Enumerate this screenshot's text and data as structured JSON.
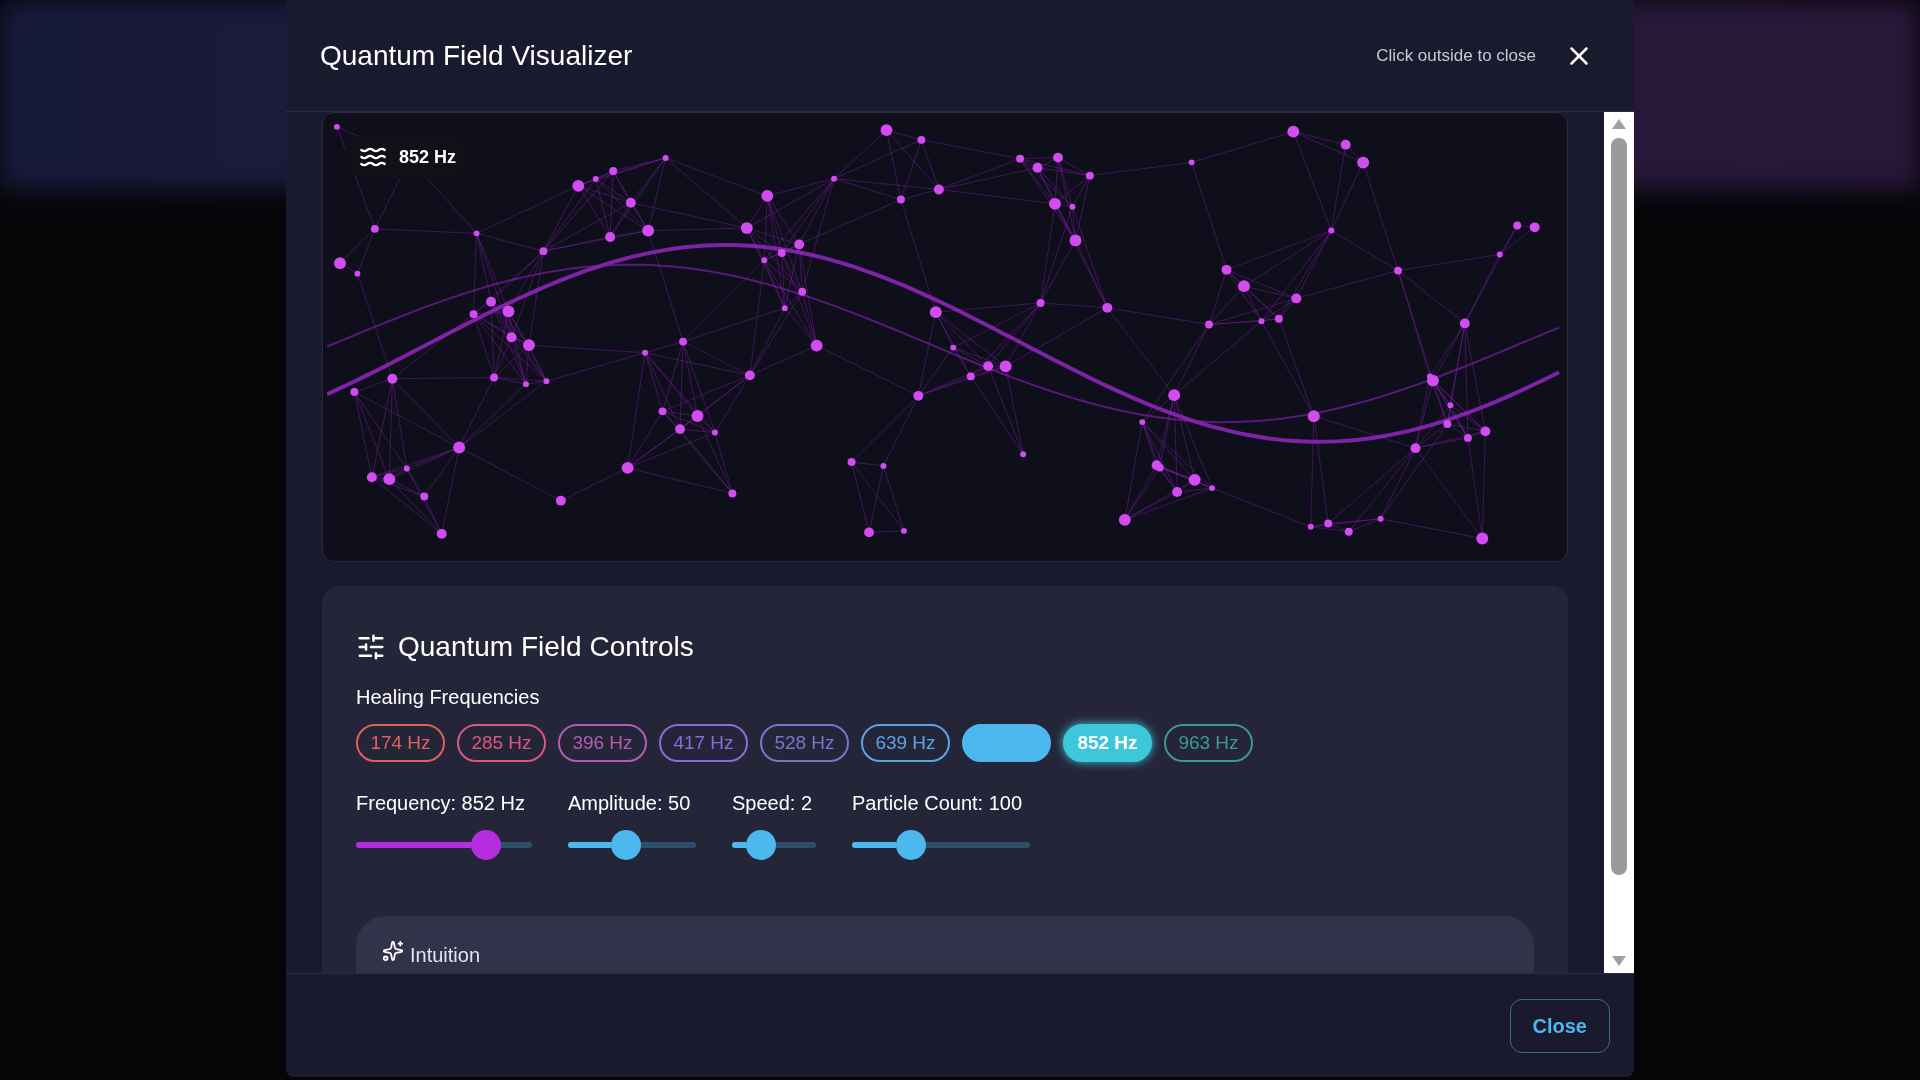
{
  "window": {
    "title": "Quantum Field Visualizer",
    "hint": "Click outside to close"
  },
  "visualizer": {
    "badge": "852 Hz"
  },
  "controls": {
    "title": "Quantum Field Controls",
    "frequencies_label": "Healing Frequencies",
    "frequencies": [
      {
        "label": "174 Hz",
        "kind": "outline",
        "color": "#e0605f",
        "selected": false
      },
      {
        "label": "285 Hz",
        "kind": "outline",
        "color": "#d8587e",
        "selected": false
      },
      {
        "label": "396 Hz",
        "kind": "outline",
        "color": "#b45cb4",
        "selected": false
      },
      {
        "label": "417 Hz",
        "kind": "outline",
        "color": "#8c6cd2",
        "selected": false
      },
      {
        "label": "528 Hz",
        "kind": "outline",
        "color": "#7c74c8",
        "selected": false
      },
      {
        "label": "639 Hz",
        "kind": "outline",
        "color": "#5ea4e4",
        "selected": false
      },
      {
        "kind": "filled",
        "color": "#4db8ee",
        "selected": false
      },
      {
        "label": "852 Hz",
        "kind": "filled",
        "color": "#3ec6da",
        "selected": true
      },
      {
        "label": "963 Hz",
        "kind": "outline",
        "color": "#3a9a90",
        "selected": false
      }
    ],
    "sliders": [
      {
        "label": "Frequency: 852 Hz",
        "level": 0.74,
        "color": "#b42ee0"
      },
      {
        "label": "Amplitude: 50",
        "level": 0.45,
        "color": "#4db8ee"
      },
      {
        "label": "Speed: 2",
        "level": 0.35,
        "color": "#4db8ee"
      },
      {
        "label": "Particle Count: 100",
        "level": 0.33,
        "color": "#4db8ee"
      }
    ],
    "section": "Intuition"
  },
  "footer": {
    "button": "Close"
  }
}
